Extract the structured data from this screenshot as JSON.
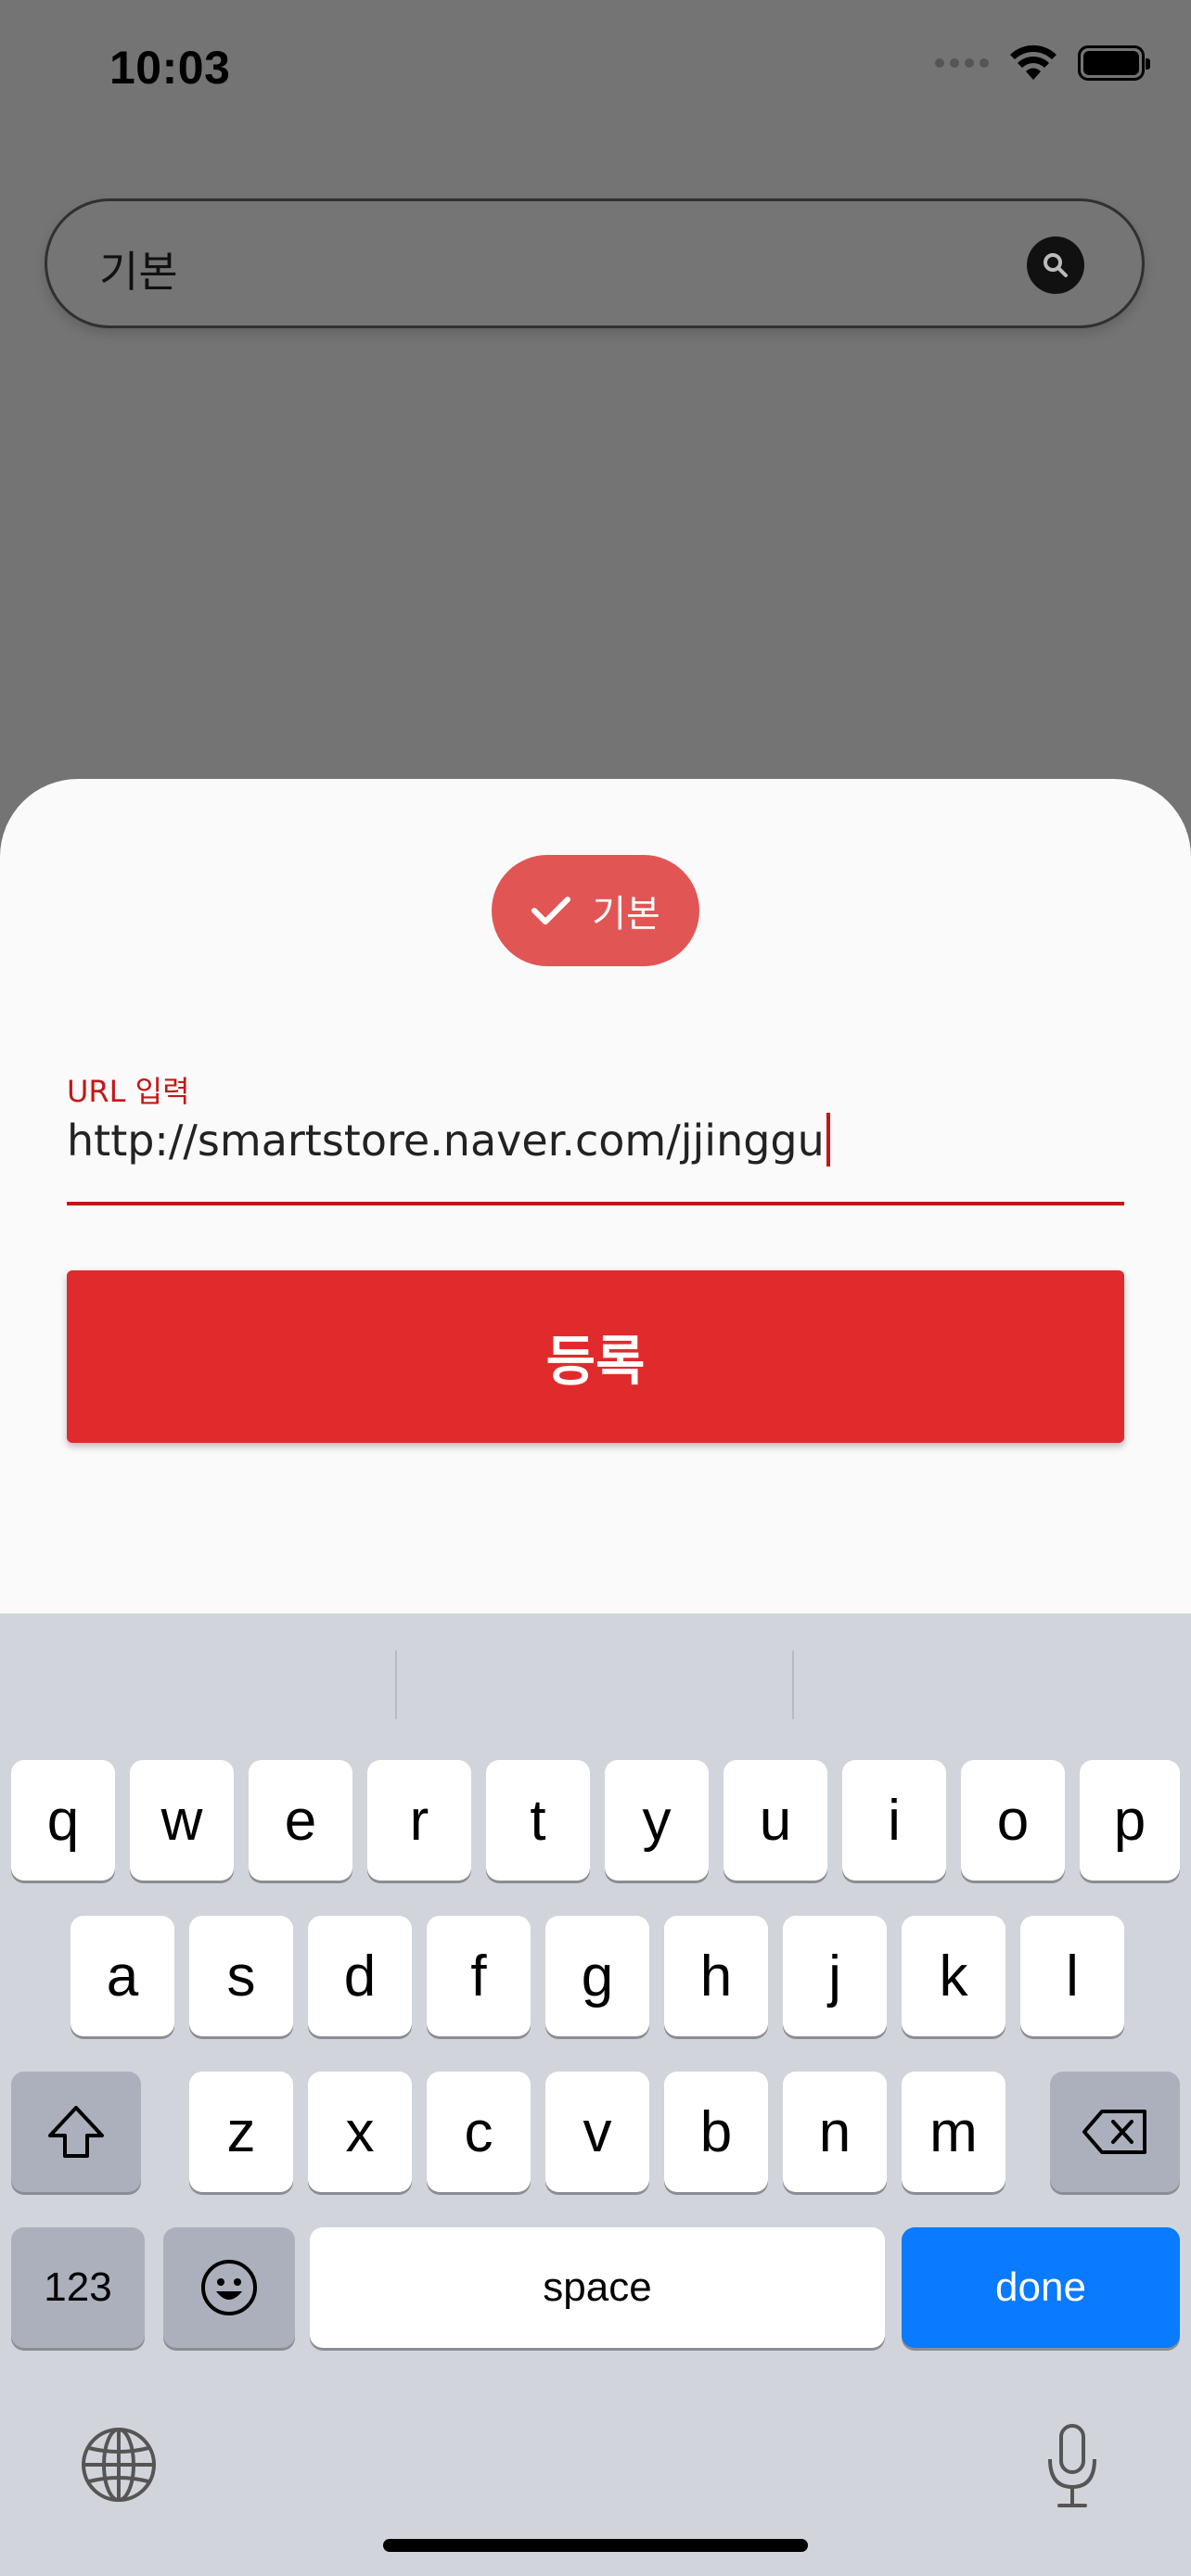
{
  "status_bar": {
    "time": "10:03"
  },
  "search": {
    "value": "기본"
  },
  "sheet": {
    "chip_label": "기본",
    "url_label": "URL 입력",
    "url_value": "http://smartstore.naver.com/jjinggu",
    "register_label": "등록"
  },
  "keyboard": {
    "row1": [
      "q",
      "w",
      "e",
      "r",
      "t",
      "y",
      "u",
      "i",
      "o",
      "p"
    ],
    "row2": [
      "a",
      "s",
      "d",
      "f",
      "g",
      "h",
      "j",
      "k",
      "l"
    ],
    "row3": [
      "z",
      "x",
      "c",
      "v",
      "b",
      "n",
      "m"
    ],
    "numbers_label": "123",
    "space_label": "space",
    "done_label": "done"
  },
  "colors": {
    "accent": "#c41717",
    "button": "#e12a2c",
    "chip": "#e25555",
    "done": "#0a7aff"
  }
}
